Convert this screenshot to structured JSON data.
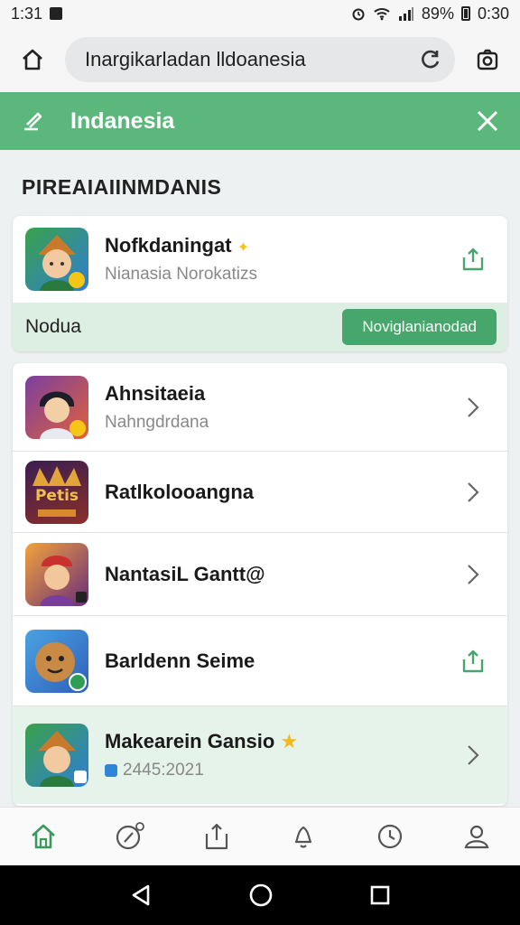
{
  "status_bar": {
    "time": "1:31",
    "battery": "89%",
    "clock": "0:30"
  },
  "browser": {
    "url": "Inargikarladan lldoanesia"
  },
  "header": {
    "title": "Indanesia"
  },
  "section": {
    "title": "PIREAIAIINMDANIS"
  },
  "featured": {
    "title": "Nofkdaningat",
    "subtitle": "Nianasia Norokatizs",
    "label": "Nodua",
    "button_label": "Noviglanianodad"
  },
  "list": [
    {
      "title": "Ahnsitaeia",
      "subtitle": "Nahngdrdana",
      "action": "chevron"
    },
    {
      "title": "Ratlkolooangna",
      "subtitle": "",
      "action": "chevron"
    },
    {
      "title": "NantasiL Gantt@",
      "subtitle": "",
      "action": "chevron"
    },
    {
      "title": "Barldenn Seime",
      "subtitle": "",
      "action": "share"
    },
    {
      "title": "Makearein Gansio",
      "subtitle": "2445:2021",
      "action": "chevron",
      "highlight": true
    }
  ],
  "icon_badges": {
    "game2": "Petis"
  },
  "colors": {
    "accent": "#5cb77c",
    "button": "#47a66b",
    "highlight": "#e5f3ea"
  }
}
